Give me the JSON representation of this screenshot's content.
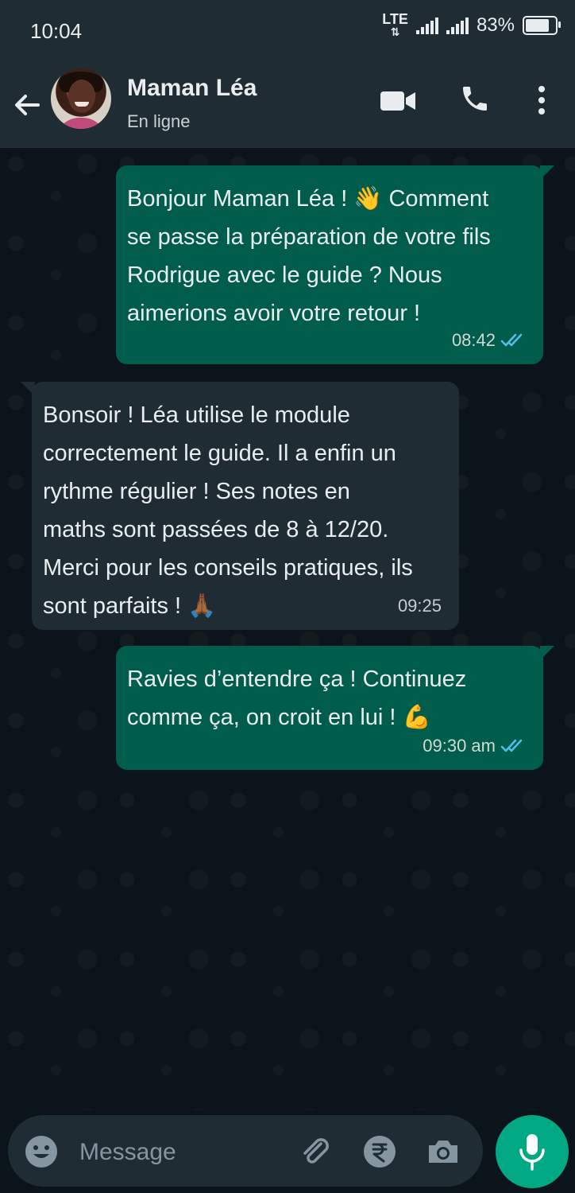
{
  "status_bar": {
    "time": "10:04",
    "network": "LTE",
    "battery_text": "83%",
    "battery_level": 0.83
  },
  "header": {
    "contact_name": "Maman Léa",
    "contact_status": "En ligne",
    "icons": [
      "back-arrow-icon",
      "video-call-icon",
      "voice-call-icon",
      "more-options-icon"
    ]
  },
  "messages": [
    {
      "direction": "outgoing",
      "text": "Bonjour Maman Léa ! 👋 Comment\nse passe la préparation de votre fils\nRodrigue avec le guide ? Nous\naimerions avoir votre retour !",
      "time": "08:42",
      "read": true
    },
    {
      "direction": "incoming",
      "text": "Bonsoir ! Léa utilise le module\ncorrectement le guide. Il a enfin un\nrythme régulier ! Ses notes en\nmaths sont passées de 8 à 12/20.\nMerci pour les conseils pratiques, ils\nsont parfaits ! 🙏🏾",
      "time": "09:25"
    },
    {
      "direction": "outgoing",
      "text": "Ravies d’entendre ça ! Continuez\ncomme ça, on croit en lui ! 💪",
      "time": "09:30 am",
      "read": true
    }
  ],
  "input": {
    "placeholder": "Message",
    "icons": [
      "emoji-icon",
      "attach-icon",
      "rupee-payment-icon",
      "camera-icon",
      "microphone-icon"
    ]
  },
  "colors": {
    "outgoing_bubble": "#005c4b",
    "incoming_bubble": "#1f2c34",
    "header_bg": "#1f2c34",
    "accent": "#00a884",
    "read_tick": "#53bdeb"
  }
}
